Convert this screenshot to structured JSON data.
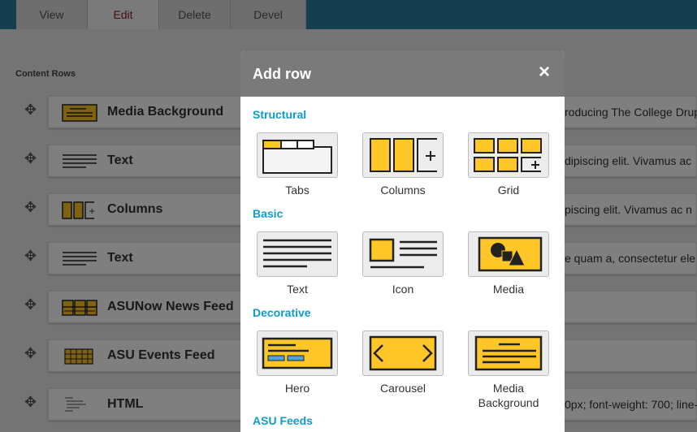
{
  "tabs": [
    {
      "label": "View"
    },
    {
      "label": "Edit"
    },
    {
      "label": "Delete"
    },
    {
      "label": "Devel"
    }
  ],
  "content_rows_label": "Content Rows",
  "rows": [
    {
      "title": "Media Background",
      "excerpt": "roducing The College Drup",
      "icon": "media-background-icon"
    },
    {
      "title": "Text",
      "excerpt": "dipiscing elit. Vivamus ac",
      "icon": "text-icon"
    },
    {
      "title": "Columns",
      "excerpt": "piscing elit. Vivamus ac n",
      "icon": "columns-icon"
    },
    {
      "title": "Text",
      "excerpt": "e quam a, consectetur ele",
      "icon": "text-icon"
    },
    {
      "title": "ASUNow News Feed",
      "excerpt": "",
      "icon": "news-feed-icon"
    },
    {
      "title": "ASU Events Feed",
      "excerpt": "",
      "icon": "events-feed-icon"
    },
    {
      "title": "HTML",
      "excerpt": "0px; font-weight: 700; line-",
      "icon": "html-icon"
    }
  ],
  "modal": {
    "title": "Add row",
    "close": "×",
    "sections": {
      "structural": "Structural",
      "basic": "Basic",
      "decorative": "Decorative",
      "asu_feeds": "ASU Feeds"
    },
    "tiles": {
      "tabs": "Tabs",
      "columns": "Columns",
      "grid": "Grid",
      "text": "Text",
      "icon": "Icon",
      "media": "Media",
      "hero": "Hero",
      "carousel": "Carousel",
      "media_background_1": "Media",
      "media_background_2": "Background"
    }
  },
  "colors": {
    "accent_yellow": "#ffc627",
    "section_blue": "#0e9bd0",
    "topbar": "#2a7fa3"
  }
}
